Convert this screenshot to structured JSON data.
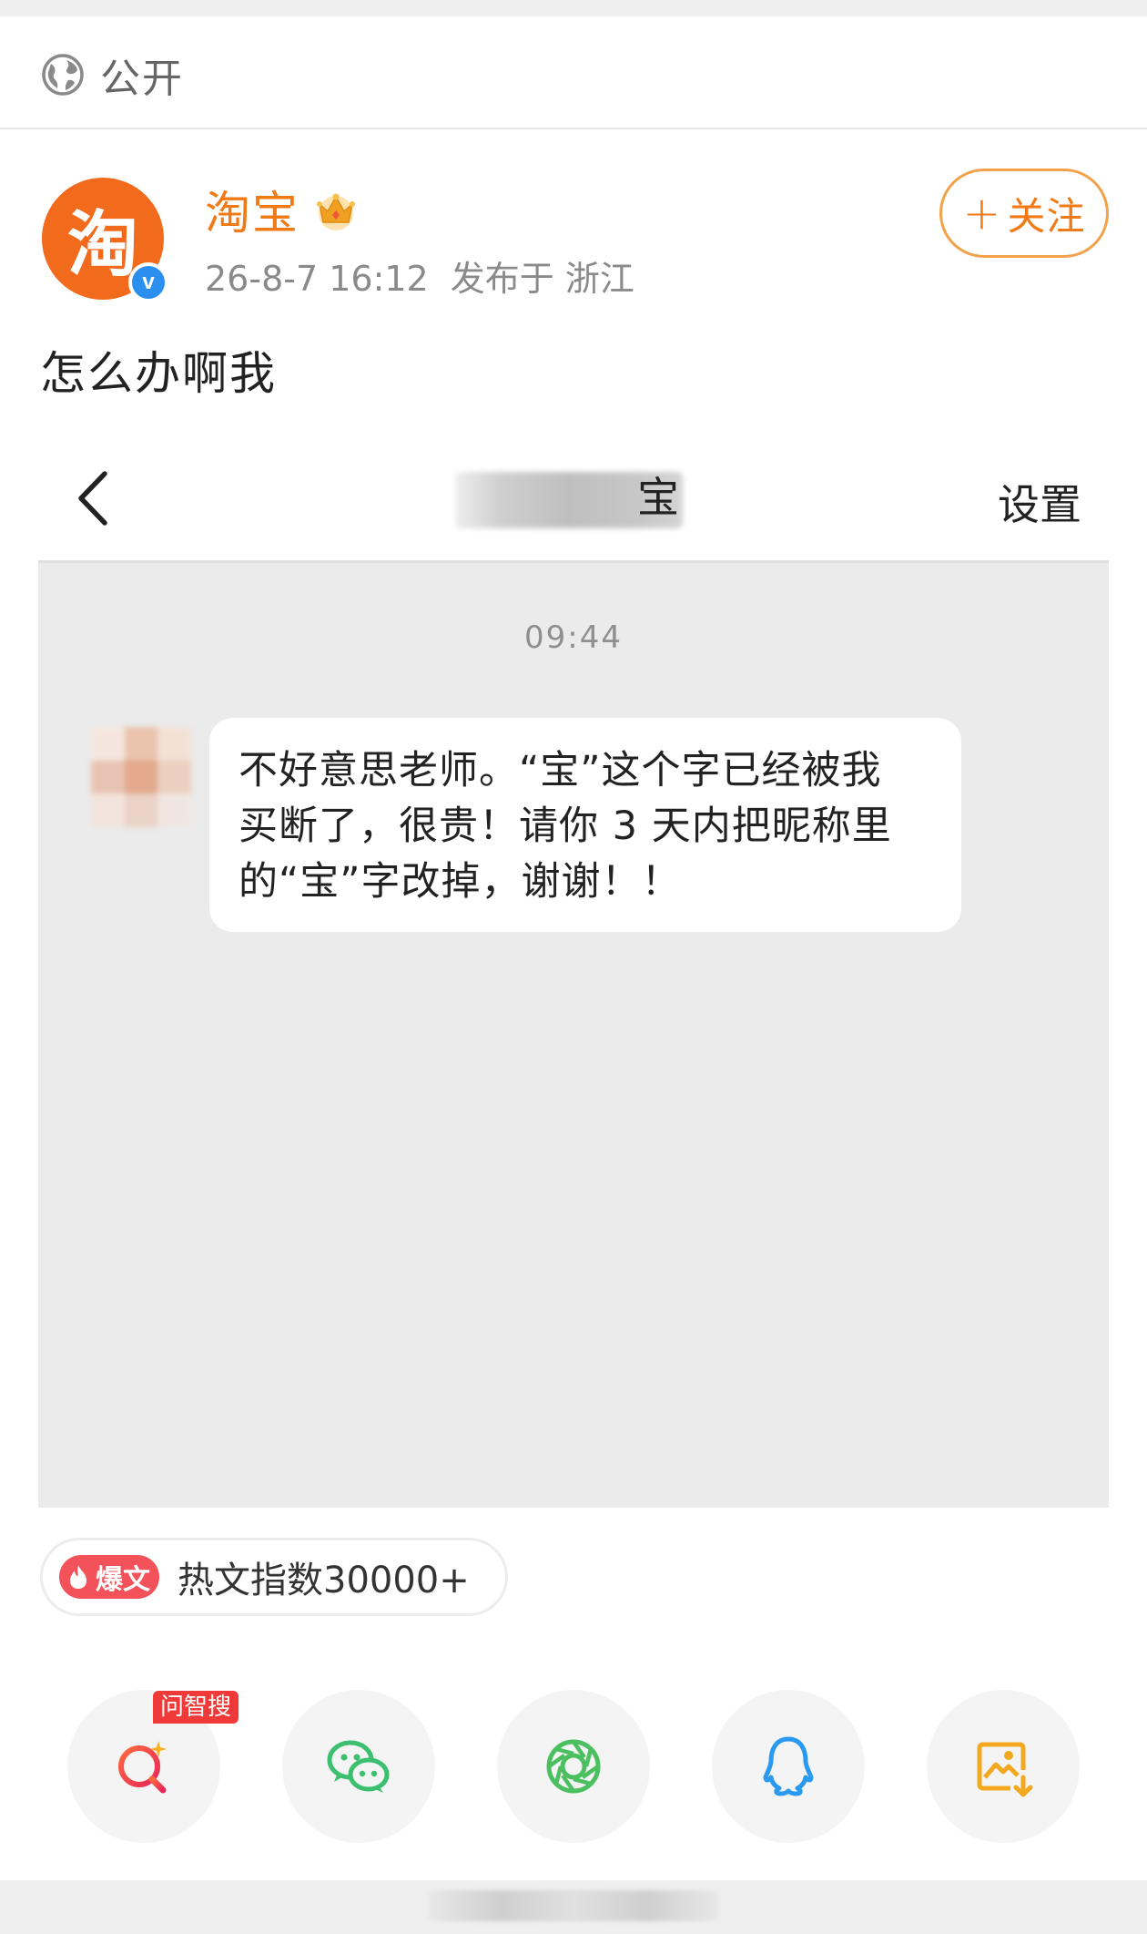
{
  "visibility": {
    "label": "公开",
    "icon": "globe-icon"
  },
  "author": {
    "name": "淘宝",
    "avatar_glyph": "淘",
    "verified_mark": "v",
    "badge_icon": "crown-icon",
    "date": "26-8-7 16:12",
    "location": "发布于 浙江",
    "brand_color": "#f26a1b",
    "name_color": "#f07a16"
  },
  "follow_button": {
    "plus": "+",
    "label": "关注"
  },
  "post": {
    "text": "怎么办啊我"
  },
  "screenshot": {
    "chat_title_suffix": "宝",
    "settings_label": "设置",
    "time": "09:44",
    "message_lines": [
      "不好意思老师。“宝”这个字已经被我",
      "买断了，很贵！请你 3 天内把昵称里",
      "的“宝”字改掉，谢谢！！"
    ]
  },
  "hot_tag": {
    "badge": "爆文",
    "label": "热文指数30000+",
    "badge_color": "#f3525a"
  },
  "share": {
    "ai_tag": "问智搜",
    "items": [
      "ai-search-icon",
      "wechat-icon",
      "moments-icon",
      "qq-icon",
      "save-image-icon"
    ]
  }
}
